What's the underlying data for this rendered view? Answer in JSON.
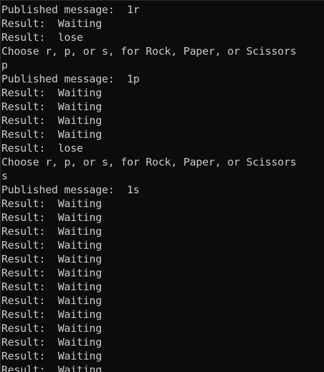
{
  "console": {
    "lines": [
      "Published message:  1r",
      "Result:  Waiting",
      "Result:  lose",
      "Choose r, p, or s, for Rock, Paper, or Scissors",
      "p",
      "Published message:  1p",
      "Result:  Waiting",
      "Result:  Waiting",
      "Result:  Waiting",
      "Result:  Waiting",
      "Result:  lose",
      "Choose r, p, or s, for Rock, Paper, or Scissors",
      "s",
      "Published message:  1s",
      "Result:  Waiting",
      "Result:  Waiting",
      "Result:  Waiting",
      "Result:  Waiting",
      "Result:  Waiting",
      "Result:  Waiting",
      "Result:  Waiting",
      "Result:  Waiting",
      "Result:  Waiting",
      "Result:  Waiting",
      "Result:  Waiting",
      "Result:  Waiting",
      "Result:  Waiting"
    ],
    "colors": {
      "background": "#0c0c0c",
      "text": "#cccccc"
    }
  }
}
